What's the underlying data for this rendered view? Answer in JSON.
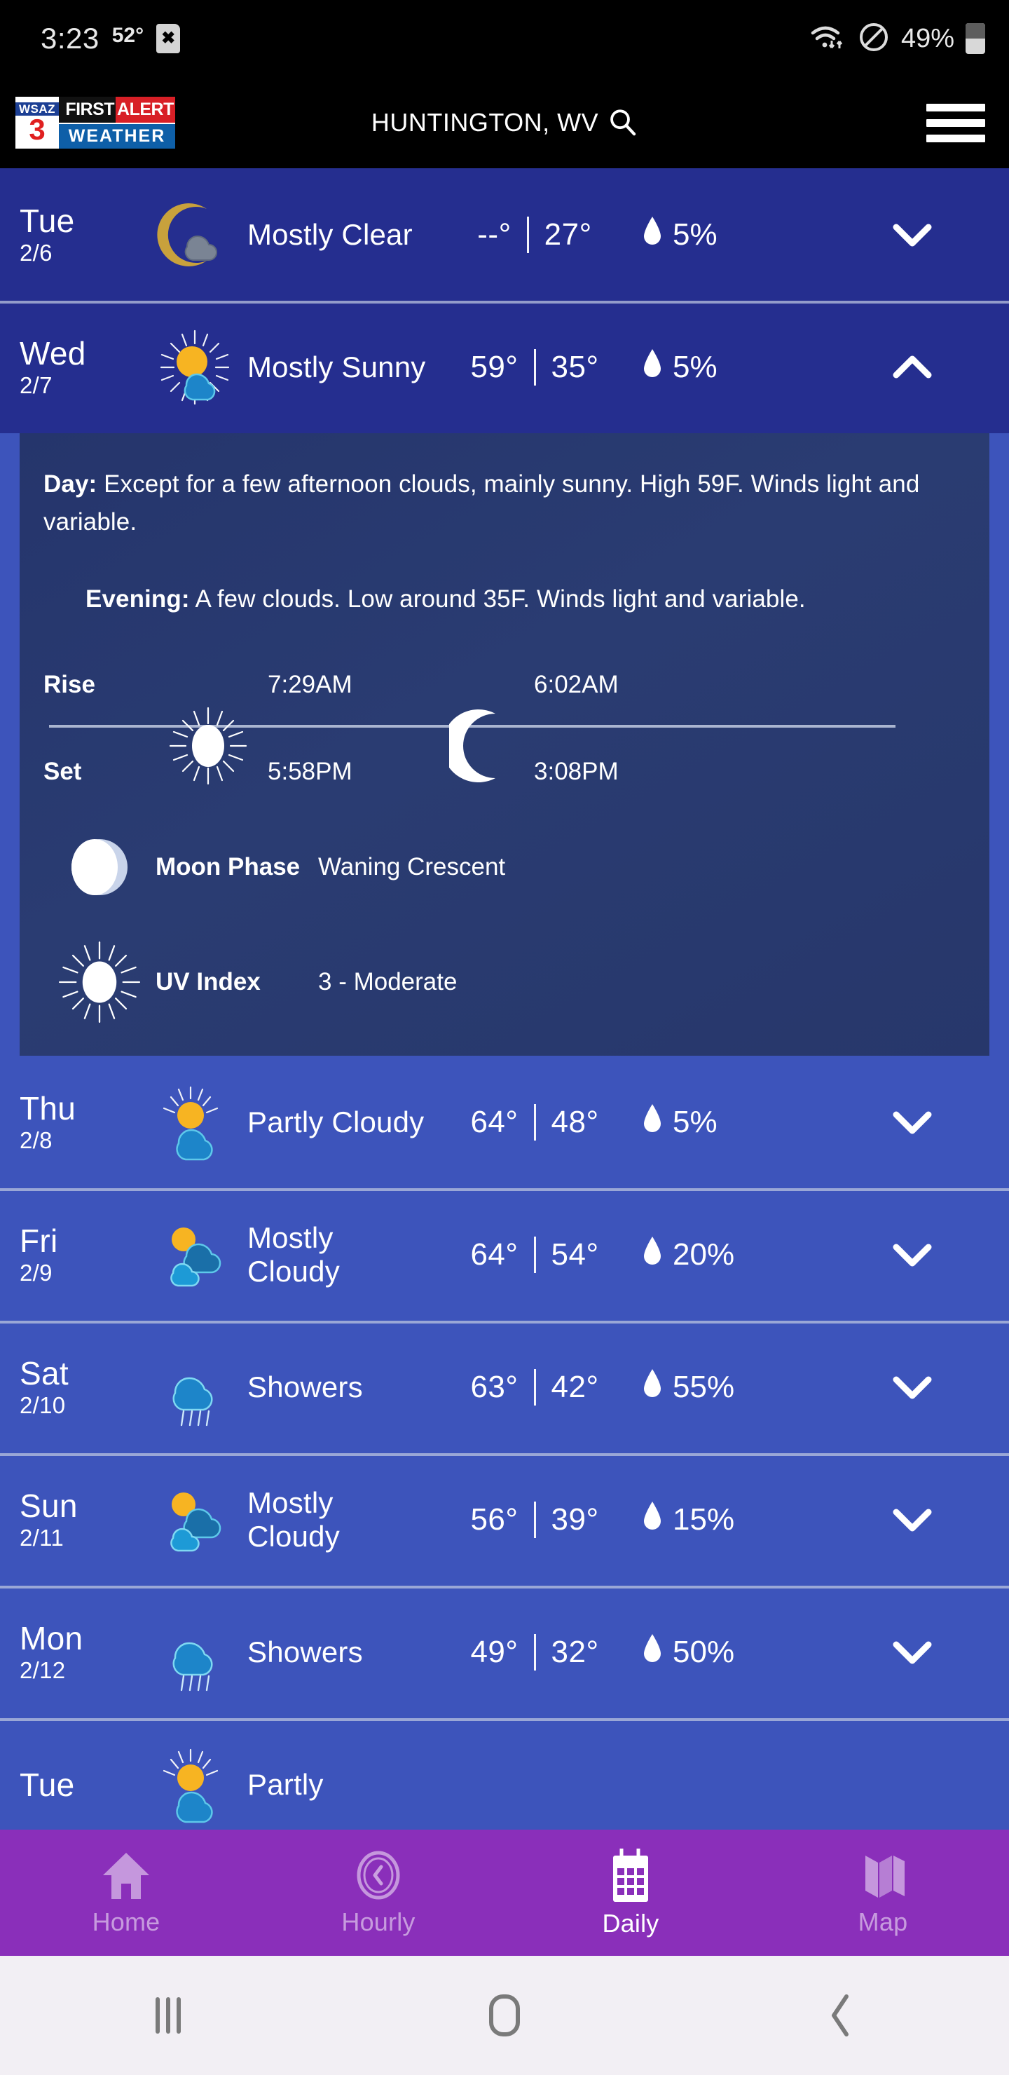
{
  "statusbar": {
    "clock": "3:23",
    "temperature": "52°",
    "sim_icon": "sim-card-x-icon",
    "sim_glyph": "✖",
    "wifi_icon": "wifi-icon",
    "dnd_icon": "do-not-disturb-icon",
    "battery_percent": "49%",
    "battery_icon": "battery-icon"
  },
  "header": {
    "logo": {
      "station": "WSAZ",
      "channel": "3",
      "first": "FIRST",
      "alert": "ALERT",
      "weather": "WEATHER"
    },
    "location": "HUNTINGTON, WV",
    "search_icon": "search-icon",
    "menu_icon": "hamburger-menu-icon"
  },
  "forecast": {
    "days": [
      {
        "dow": "Tue",
        "date": "2/6",
        "icon": "moon-cloud-icon",
        "condition": "Mostly Clear",
        "high": "--°",
        "low": "27°",
        "pop": "5%",
        "chevron": "chevron-down-icon",
        "expanded": false,
        "theme": "dark"
      },
      {
        "dow": "Wed",
        "date": "2/7",
        "icon": "sun-cloud-icon",
        "condition": "Mostly Sunny",
        "high": "59°",
        "low": "35°",
        "pop": "5%",
        "chevron": "chevron-up-icon",
        "expanded": true,
        "theme": "dark"
      },
      {
        "dow": "Thu",
        "date": "2/8",
        "icon": "sun-behind-cloud-icon",
        "condition": "Partly Cloudy",
        "high": "64°",
        "low": "48°",
        "pop": "5%",
        "chevron": "chevron-down-icon",
        "expanded": false,
        "theme": "light"
      },
      {
        "dow": "Fri",
        "date": "2/9",
        "icon": "sun-two-clouds-icon",
        "condition": "Mostly Cloudy",
        "high": "64°",
        "low": "54°",
        "pop": "20%",
        "chevron": "chevron-down-icon",
        "expanded": false,
        "theme": "light"
      },
      {
        "dow": "Sat",
        "date": "2/10",
        "icon": "rain-cloud-icon",
        "condition": "Showers",
        "high": "63°",
        "low": "42°",
        "pop": "55%",
        "chevron": "chevron-down-icon",
        "expanded": false,
        "theme": "light"
      },
      {
        "dow": "Sun",
        "date": "2/11",
        "icon": "sun-two-clouds-icon",
        "condition": "Mostly Cloudy",
        "high": "56°",
        "low": "39°",
        "pop": "15%",
        "chevron": "chevron-down-icon",
        "expanded": false,
        "theme": "light"
      },
      {
        "dow": "Mon",
        "date": "2/12",
        "icon": "rain-cloud-icon",
        "condition": "Showers",
        "high": "49°",
        "low": "32°",
        "pop": "50%",
        "chevron": "chevron-down-icon",
        "expanded": false,
        "theme": "light"
      },
      {
        "dow": "Tue",
        "date": "",
        "icon": "sun-behind-cloud-icon",
        "condition": "Partly",
        "high": "",
        "low": "",
        "pop": "",
        "chevron": "chevron-down-icon",
        "expanded": false,
        "theme": "light"
      }
    ]
  },
  "details": {
    "day_label": "Day:",
    "day_text": " Except for a few afternoon clouds, mainly sunny. High 59F. Winds light and variable.",
    "evening_label": "Evening:",
    "evening_text": " A few clouds. Low around 35F. Winds light and variable.",
    "rise_label": "Rise",
    "set_label": "Set",
    "sun_icon": "sun-icon",
    "moon_icon": "crescent-moon-icon",
    "sunrise": "7:29AM",
    "sunset": "5:58PM",
    "moonrise": "6:02AM",
    "moonset": "3:08PM",
    "moon_phase_icon": "moon-phase-icon",
    "moon_phase_label": "Moon Phase",
    "moon_phase_value": "Waning Crescent",
    "uv_icon": "uv-sun-icon",
    "uv_label": "UV Index",
    "uv_value": "3 - Moderate"
  },
  "tabbar": {
    "items": [
      {
        "label": "Home",
        "icon": "home-icon",
        "active": false
      },
      {
        "label": "Hourly",
        "icon": "clock-icon",
        "active": false
      },
      {
        "label": "Daily",
        "icon": "calendar-icon",
        "active": true
      },
      {
        "label": "Map",
        "icon": "map-icon",
        "active": false
      }
    ]
  },
  "sysnav": {
    "recents": "recents-icon",
    "home": "home-button-icon",
    "back": "back-icon"
  },
  "colors": {
    "accent_purple": "#8a2fba",
    "row_dark": "#252e8f",
    "row_light": "#3d54bb",
    "panel": "#27376b",
    "alert_red": "#d81f26",
    "logo_blue": "#0e5fa8"
  }
}
